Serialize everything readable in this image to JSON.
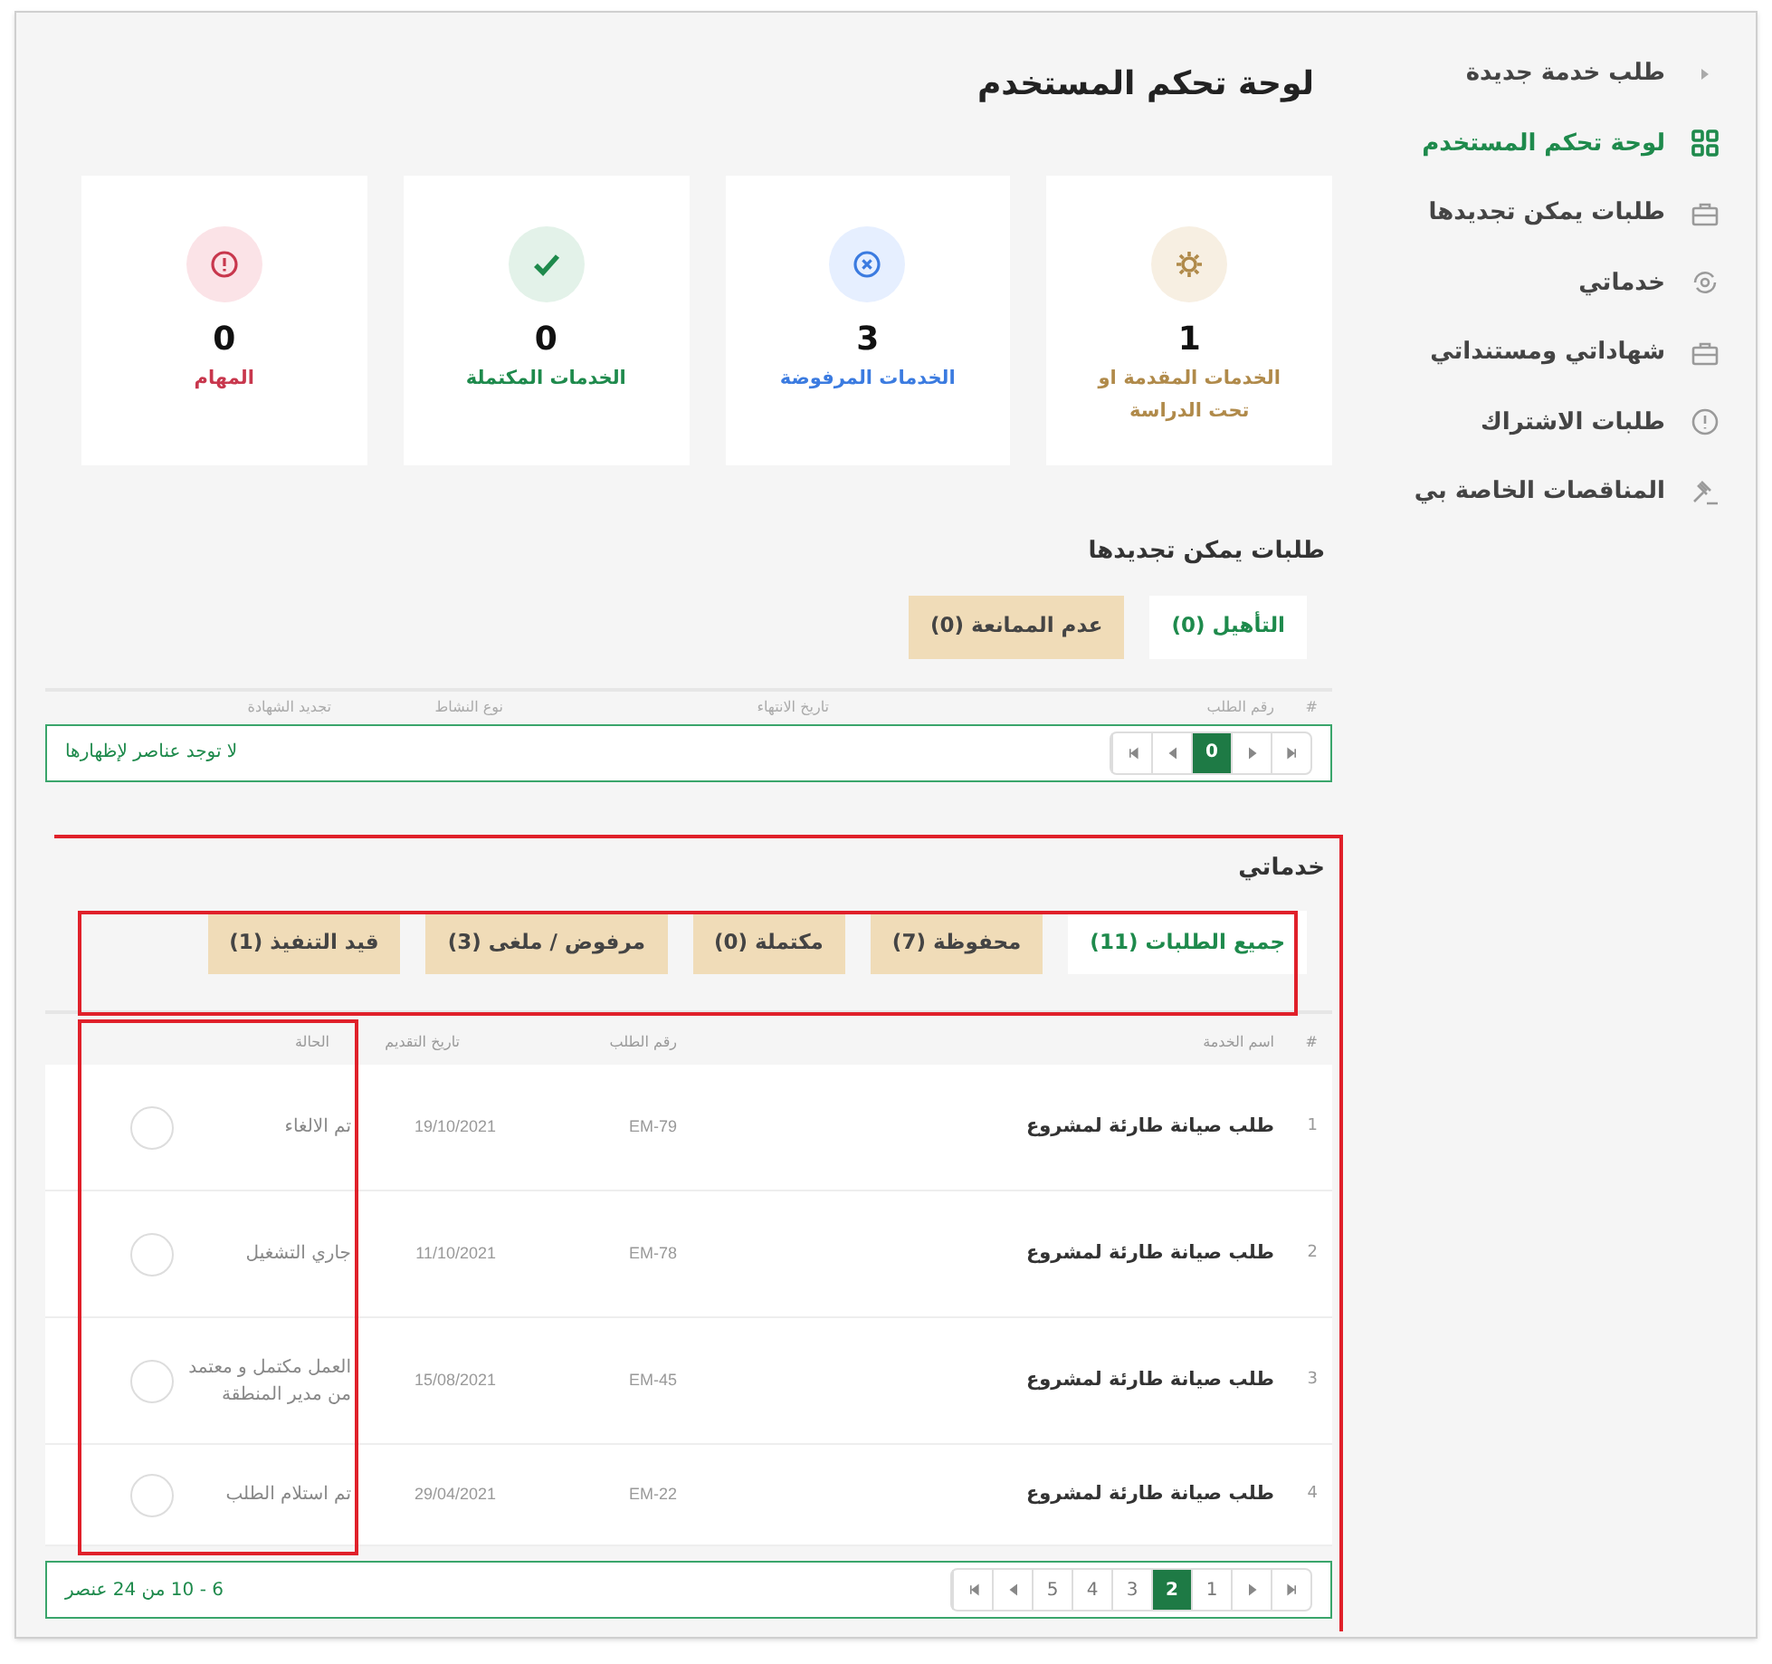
{
  "sidebar": {
    "items": [
      {
        "label": "طلب خدمة جديدة",
        "kind": "caret",
        "selected": false
      },
      {
        "label": "لوحة تحكم المستخدم",
        "kind": "grid",
        "selected": true
      },
      {
        "label": "طلبات يمكن تجديدها",
        "kind": "briefcase",
        "selected": false
      },
      {
        "label": "خدماتي",
        "kind": "cycle",
        "selected": false
      },
      {
        "label": "شهاداتي ومستنداتي",
        "kind": "briefcase",
        "selected": false
      },
      {
        "label": "طلبات الاشتراك",
        "kind": "alert",
        "selected": false
      },
      {
        "label": "المناقصات الخاصة بي",
        "kind": "gavel",
        "selected": false
      }
    ]
  },
  "page_title": "لوحة تحكم المستخدم",
  "stats": [
    {
      "kind": "gear",
      "value": "1",
      "label": "الخدمات المقدمة او تحت الدراسة",
      "color": "#b08a4a"
    },
    {
      "kind": "cross",
      "value": "3",
      "label": "الخدمات المرفوضة",
      "color": "#3b7be0"
    },
    {
      "kind": "check",
      "value": "0",
      "label": "الخدمات المكتملة",
      "color": "#1e8a4c"
    },
    {
      "kind": "alert",
      "value": "0",
      "label": "المهام",
      "color": "#c8374d"
    }
  ],
  "renewable": {
    "title": "طلبات يمكن تجديدها",
    "tabs": [
      {
        "label": "التأهيل (0)",
        "selected": true
      },
      {
        "label": "عدم الممانعة (0)",
        "selected": false
      }
    ],
    "columns": [
      "#",
      "رقم الطلب",
      "تاريخ الانتهاء",
      "نوع النشاط",
      "تجديد الشهادة"
    ],
    "empty_message": "لا توجد عناصر لإظهارها",
    "pager": [
      {
        "kind": "first"
      },
      {
        "kind": "prev"
      },
      {
        "kind": "page",
        "label": "0",
        "selected": true
      },
      {
        "kind": "next"
      },
      {
        "kind": "last"
      }
    ]
  },
  "my_services": {
    "title": "خدماتي",
    "tabs": [
      {
        "label": "جميع الطلبات (11)",
        "selected": true
      },
      {
        "label": "محفوظة (7)",
        "selected": false
      },
      {
        "label": "مكتملة (0)",
        "selected": false
      },
      {
        "label": "مرفوض / ملغى (3)",
        "selected": false
      },
      {
        "label": "قيد التنفيذ (1)",
        "selected": false
      }
    ],
    "columns": [
      "#",
      "اسم الخدمة",
      "رقم الطلب",
      "تاريخ التقديم",
      "الحالة"
    ],
    "rows": [
      {
        "num": "1",
        "service": "طلب صيانة طارئة لمشروع",
        "request_no": "EM-79",
        "date": "19/10/2021",
        "status": "تم الالغاء"
      },
      {
        "num": "2",
        "service": "طلب صيانة طارئة لمشروع",
        "request_no": "EM-78",
        "date": "11/10/2021",
        "status": "جاري التشغيل"
      },
      {
        "num": "3",
        "service": "طلب صيانة طارئة لمشروع",
        "request_no": "EM-45",
        "date": "15/08/2021",
        "status": "العمل مكتمل و معتمد من مدير المنطقة"
      },
      {
        "num": "4",
        "service": "طلب صيانة طارئة لمشروع",
        "request_no": "EM-22",
        "date": "29/04/2021",
        "status": "تم استلام الطلب"
      }
    ],
    "pager": [
      {
        "kind": "first"
      },
      {
        "kind": "prev"
      },
      {
        "kind": "page",
        "label": "1",
        "selected": false
      },
      {
        "kind": "page",
        "label": "2",
        "selected": true
      },
      {
        "kind": "page",
        "label": "3",
        "selected": false
      },
      {
        "kind": "page",
        "label": "4",
        "selected": false
      },
      {
        "kind": "page",
        "label": "5",
        "selected": false
      },
      {
        "kind": "next"
      },
      {
        "kind": "last"
      }
    ],
    "range": "6 - 10 من 24 عنصر"
  }
}
